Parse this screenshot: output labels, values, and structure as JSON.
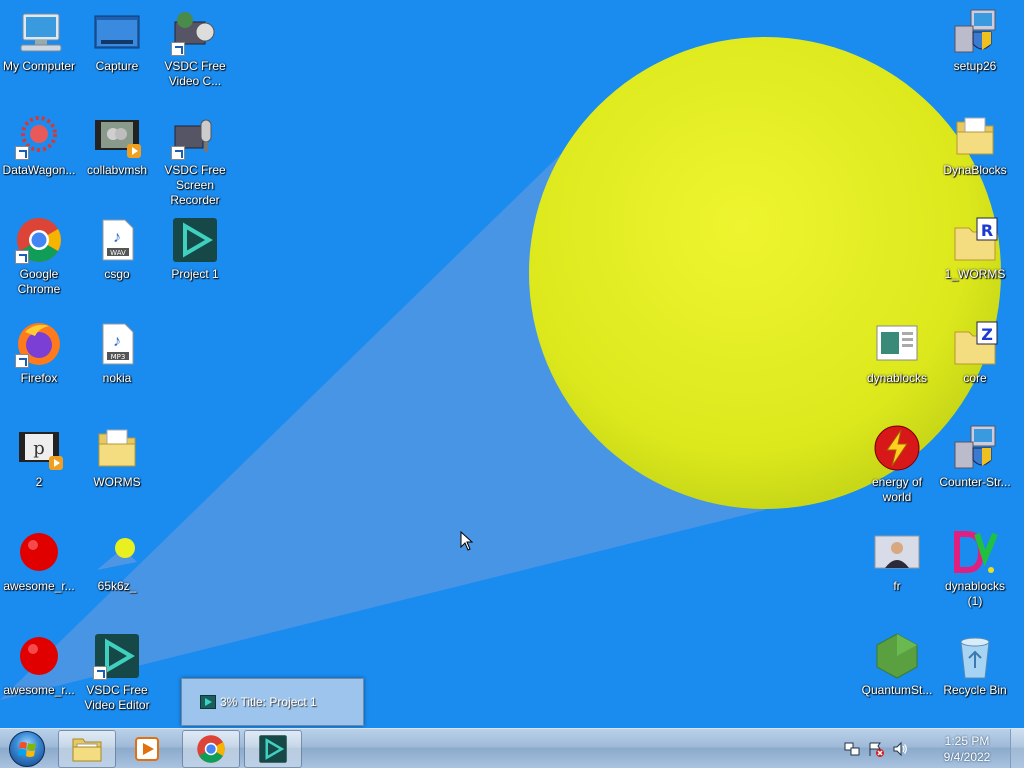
{
  "desktop": {
    "wallpaper": {
      "background_color": "#1a8cf0",
      "ball_color": "#e8f020",
      "beam_color": "#4e96e4"
    },
    "icons": [
      {
        "label": "My Computer",
        "icon": "computer-icon"
      },
      {
        "label": "Capture",
        "icon": "capture-window-icon"
      },
      {
        "label": "VSDC Free Video C...",
        "icon": "vsdc-converter-icon"
      },
      {
        "label": "DataWagon...",
        "icon": "datawagon-icon"
      },
      {
        "label": "collabvmsh",
        "icon": "video-file-icon"
      },
      {
        "label": "VSDC Free Screen Recorder",
        "icon": "vsdc-recorder-icon"
      },
      {
        "label": "Google Chrome",
        "icon": "chrome-icon"
      },
      {
        "label": "csgo",
        "icon": "wav-file-icon"
      },
      {
        "label": "Project 1",
        "icon": "vsdc-project-icon"
      },
      {
        "label": "Firefox",
        "icon": "firefox-icon"
      },
      {
        "label": "nokia",
        "icon": "mp3-file-icon"
      },
      {
        "label": "2",
        "icon": "video-file-icon"
      },
      {
        "label": "WORMS",
        "icon": "folder-icon"
      },
      {
        "label": "awesome_r...",
        "icon": "red-ball-icon"
      },
      {
        "label": "65k6z_",
        "icon": "yellow-ball-image-icon"
      },
      {
        "label": "awesome_r...",
        "icon": "red-ball-icon"
      },
      {
        "label": "VSDC Free Video Editor",
        "icon": "vsdc-editor-icon"
      },
      {
        "label": "setup26",
        "icon": "installer-icon"
      },
      {
        "label": "DynaBlocks",
        "icon": "folder-icon"
      },
      {
        "label": "1_WORMS",
        "icon": "rar-archive-icon"
      },
      {
        "label": "dynablocks",
        "icon": "webpage-file-icon"
      },
      {
        "label": "core",
        "icon": "zip-archive-icon"
      },
      {
        "label": "energy of world",
        "icon": "energy-icon"
      },
      {
        "label": "Counter-Str...",
        "icon": "installer-icon"
      },
      {
        "label": "fr",
        "icon": "photo-icon"
      },
      {
        "label": "dynablocks (1)",
        "icon": "dynablocks-logo-icon"
      },
      {
        "label": "QuantumSt...",
        "icon": "nodejs-icon"
      },
      {
        "label": "Recycle Bin",
        "icon": "recycle-bin-icon"
      }
    ]
  },
  "progress_popup": {
    "text": "3% Title: Project 1",
    "icon": "vsdc-icon"
  },
  "taskbar": {
    "start_icon": "windows-start-orb",
    "buttons": [
      {
        "name": "explorer",
        "icon": "folder-library-icon",
        "active": true
      },
      {
        "name": "media-player",
        "icon": "media-player-icon",
        "active": false
      },
      {
        "name": "chrome",
        "icon": "chrome-icon",
        "active": true
      },
      {
        "name": "vsdc",
        "icon": "vsdc-icon",
        "active": true
      }
    ],
    "tray_icons": [
      "network-icon",
      "action-center-flag-icon",
      "volume-icon"
    ],
    "clock": {
      "time": "1:25 PM",
      "date": "9/4/2022"
    }
  }
}
